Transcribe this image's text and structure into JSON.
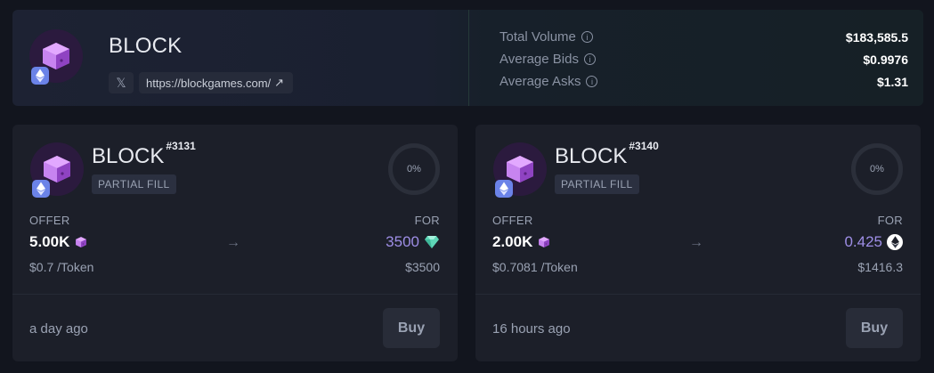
{
  "collection": {
    "name": "BLOCK",
    "x_icon": "x-logo-icon",
    "website": "https://blockgames.com/",
    "link_icon": "external-link-arrow-icon"
  },
  "stats": [
    {
      "label": "Total Volume",
      "value": "$183,585.5"
    },
    {
      "label": "Average Bids",
      "value": "$0.9976"
    },
    {
      "label": "Average Asks",
      "value": "$1.31"
    }
  ],
  "listings": [
    {
      "name": "BLOCK",
      "id": "#3131",
      "badge": "PARTIAL FILL",
      "progress": "0%",
      "offer_label": "OFFER",
      "for_label": "FOR",
      "offer_amount": "5.00K",
      "for_amount": "3500",
      "for_icon": "diamond-gem-icon",
      "offer_price": "$0.7 /Token",
      "for_price": "$3500",
      "time": "a day ago",
      "buy": "Buy"
    },
    {
      "name": "BLOCK",
      "id": "#3140",
      "badge": "PARTIAL FILL",
      "progress": "0%",
      "offer_label": "OFFER",
      "for_label": "FOR",
      "offer_amount": "2.00K",
      "for_amount": "0.425",
      "for_icon": "ethereum-icon",
      "offer_price": "$0.7081 /Token",
      "for_price": "$1416.3",
      "time": "16 hours ago",
      "buy": "Buy"
    }
  ],
  "colors": {
    "accent": "#9e8ee6",
    "background": "#12151e",
    "card": "#1c1f29"
  }
}
